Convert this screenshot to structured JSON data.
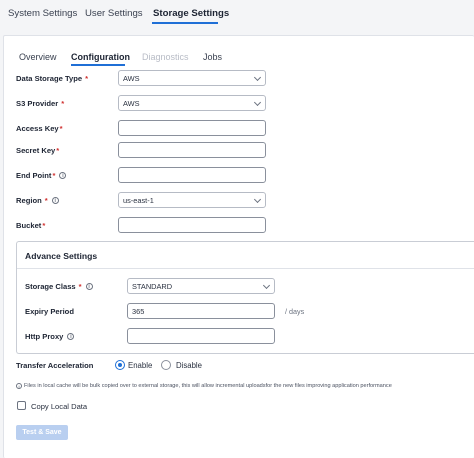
{
  "top_tabs": [
    {
      "label": "System Settings"
    },
    {
      "label": "User Settings"
    },
    {
      "label": "Storage Settings"
    }
  ],
  "sub_tabs": [
    {
      "label": "Overview"
    },
    {
      "label": "Configuration"
    },
    {
      "label": "Diagnostics"
    },
    {
      "label": "Jobs"
    }
  ],
  "form": {
    "data_storage_type": {
      "label": "Data Storage Type",
      "value": "AWS"
    },
    "s3_provider": {
      "label": "S3 Provider",
      "value": "AWS"
    },
    "access_key": {
      "label": "Access Key",
      "value": ""
    },
    "secret_key": {
      "label": "Secret Key",
      "value": ""
    },
    "end_point": {
      "label": "End Point",
      "value": ""
    },
    "region": {
      "label": "Region",
      "value": "us-east-1"
    },
    "bucket": {
      "label": "Bucket",
      "value": ""
    }
  },
  "advance": {
    "title": "Advance Settings",
    "storage_class": {
      "label": "Storage Class",
      "value": "STANDARD"
    },
    "expiry_period": {
      "label": "Expiry Period",
      "value": "365",
      "suffix": "/ days"
    },
    "http_proxy": {
      "label": "Http Proxy",
      "value": ""
    }
  },
  "transfer": {
    "label": "Transfer Acceleration",
    "options": [
      "Enable",
      "Disable"
    ],
    "selected": "Enable"
  },
  "note": "Files in local cache will be bulk copied over to external storage, this will allow incremental uploadsfor the new files improving application performance",
  "copy_local": {
    "label": "Copy Local Data",
    "checked": false
  },
  "submit": {
    "label": "Test & Save"
  },
  "colors": {
    "accent": "#1f6fd6",
    "required": "#d0302f",
    "button_disabled": "#b9cff0"
  }
}
